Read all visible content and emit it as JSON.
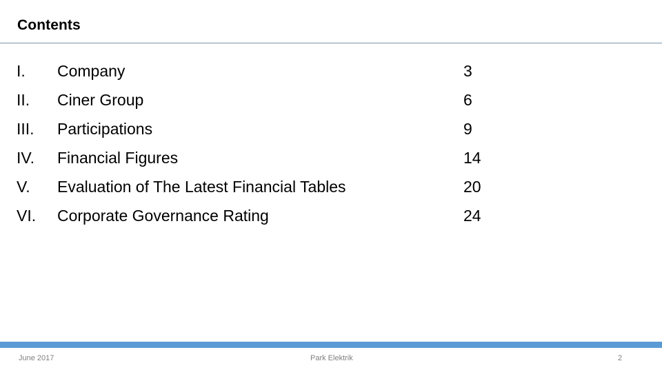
{
  "slide": {
    "title": "Contents",
    "background_color": "#ffffff",
    "rule_color": "#7795a8"
  },
  "contents": {
    "rows": [
      {
        "numeral": "I.",
        "label": "Company",
        "page": "3"
      },
      {
        "numeral": "II.",
        "label": "Ciner Group",
        "page": "6"
      },
      {
        "numeral": "III.",
        "label": "Participations",
        "page": "9"
      },
      {
        "numeral": "IV.",
        "label": "Financial Figures",
        "page": "14"
      },
      {
        "numeral": "V.",
        "label": "Evaluation of The Latest Financial Tables",
        "page": "20"
      },
      {
        "numeral": "VI.",
        "label": "Corporate Governance Rating",
        "page": "24"
      }
    ]
  },
  "footer": {
    "date": "June 2017",
    "company": "Park Elektrik",
    "page_number": "2",
    "bar_color": "#5b9bd5",
    "text_color": "#808080"
  }
}
